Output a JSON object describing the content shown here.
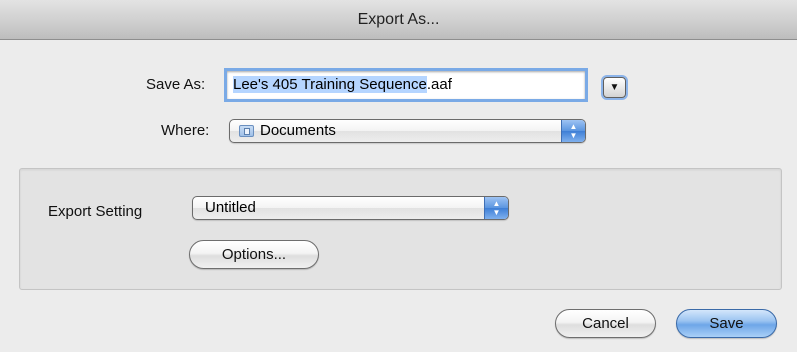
{
  "window": {
    "title": "Export As..."
  },
  "save_as": {
    "label": "Save As:",
    "filename_selected": "Lee's 405 Training Sequence",
    "filename_extension": ".aaf",
    "disclosure_icon": "triangle-down-icon"
  },
  "where": {
    "label": "Where:",
    "value": "Documents",
    "icon": "folder-icon"
  },
  "export_setting": {
    "label": "Export Setting",
    "value": "Untitled",
    "options_label": "Options..."
  },
  "buttons": {
    "cancel": "Cancel",
    "save": "Save"
  },
  "colors": {
    "window_bg": "#ececec",
    "focus_ring": "#7aaae6",
    "selection": "#b5d5ff",
    "default_button": "#6ea6e8"
  }
}
